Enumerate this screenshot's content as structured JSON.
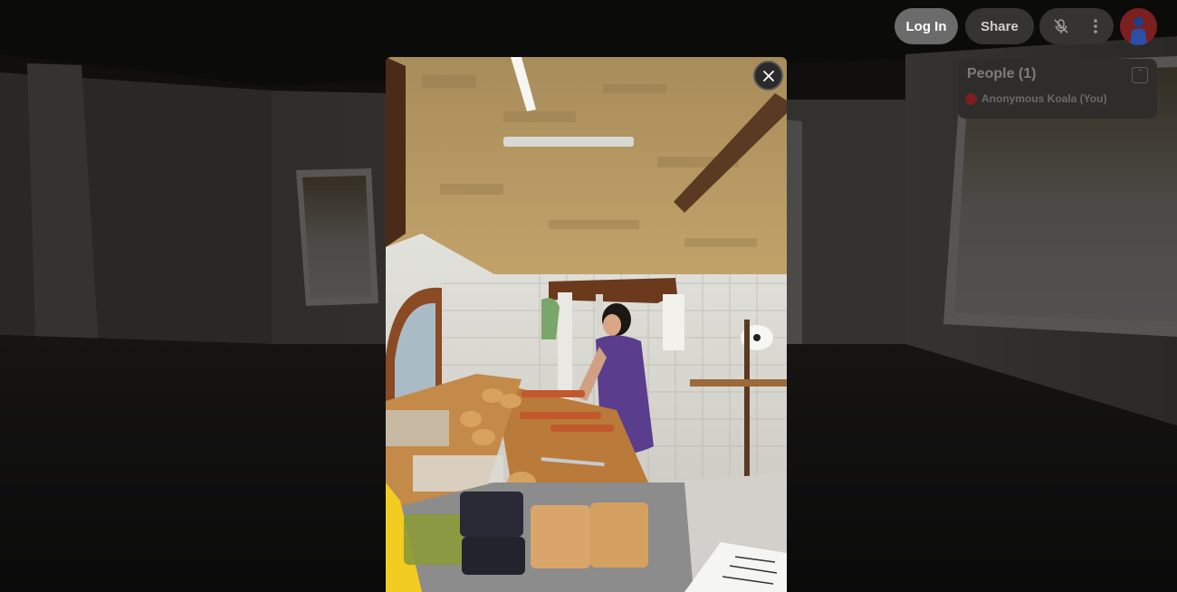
{
  "toolbar": {
    "login_label": "Log In",
    "share_label": "Share",
    "mic_icon": "mic-off-icon",
    "more_icon": "more-vertical-icon",
    "avatar_icon": "user-avatar"
  },
  "people_panel": {
    "title": "People (1)",
    "members": [
      {
        "name": "Anonymous Koala (You)",
        "color": "#7a1f1f"
      }
    ]
  },
  "modal": {
    "close_icon": "close-icon"
  },
  "colors": {
    "login_bg": "#6b6b6b",
    "toolbar_bg": "#353433",
    "panel_bg": "#2e2d2b",
    "avatar_bg": "#7a2020"
  }
}
